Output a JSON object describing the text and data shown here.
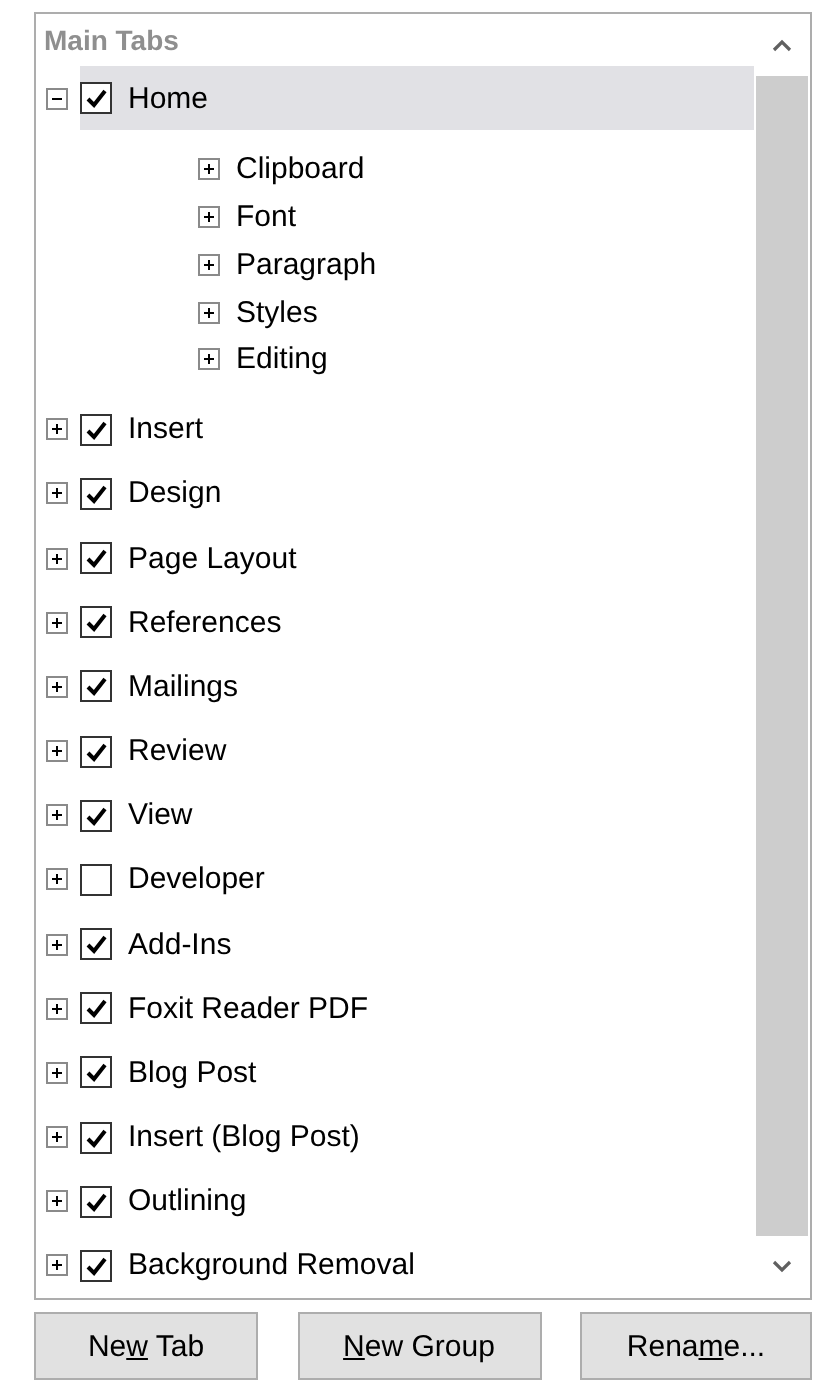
{
  "list_header": "Main Tabs",
  "tabs": [
    {
      "label": "Home",
      "kind": "tab",
      "checked": true,
      "expanded": true,
      "selected": true,
      "children": [
        {
          "label": "Clipboard",
          "kind": "group",
          "expanded": false,
          "selected": false
        },
        {
          "label": "Font",
          "kind": "group",
          "expanded": false,
          "selected": false
        },
        {
          "label": "Paragraph",
          "kind": "group",
          "expanded": false,
          "selected": false
        },
        {
          "label": "Styles",
          "kind": "group",
          "expanded": false,
          "selected": false
        },
        {
          "label": "Editing",
          "kind": "group",
          "expanded": false,
          "selected": false
        }
      ]
    },
    {
      "label": "Insert",
      "kind": "tab",
      "checked": true,
      "expanded": false,
      "selected": false
    },
    {
      "label": "Design",
      "kind": "tab",
      "checked": true,
      "expanded": false,
      "selected": false
    },
    {
      "label": "Page Layout",
      "kind": "tab",
      "checked": true,
      "expanded": false,
      "selected": false
    },
    {
      "label": "References",
      "kind": "tab",
      "checked": true,
      "expanded": false,
      "selected": false
    },
    {
      "label": "Mailings",
      "kind": "tab",
      "checked": true,
      "expanded": false,
      "selected": false
    },
    {
      "label": "Review",
      "kind": "tab",
      "checked": true,
      "expanded": false,
      "selected": false
    },
    {
      "label": "View",
      "kind": "tab",
      "checked": true,
      "expanded": false,
      "selected": false
    },
    {
      "label": "Developer",
      "kind": "tab",
      "checked": false,
      "expanded": false,
      "selected": false
    },
    {
      "label": "Add-Ins",
      "kind": "tab",
      "checked": true,
      "expanded": false,
      "selected": false
    },
    {
      "label": "Foxit Reader PDF",
      "kind": "tab",
      "checked": true,
      "expanded": false,
      "selected": false
    },
    {
      "label": "Blog Post",
      "kind": "tab",
      "checked": true,
      "expanded": false,
      "selected": false
    },
    {
      "label": "Insert (Blog Post)",
      "kind": "tab",
      "checked": true,
      "expanded": false,
      "selected": false
    },
    {
      "label": "Outlining",
      "kind": "tab",
      "checked": true,
      "expanded": false,
      "selected": false
    },
    {
      "label": "Background Removal",
      "kind": "tab",
      "checked": true,
      "expanded": false,
      "selected": false
    }
  ],
  "buttons": [
    {
      "before": "Ne",
      "access_key": "w",
      "after": " Tab"
    },
    {
      "access_key": "N",
      "after": "ew Group"
    },
    {
      "before": "Rena",
      "access_key": "m",
      "after": "e..."
    }
  ]
}
